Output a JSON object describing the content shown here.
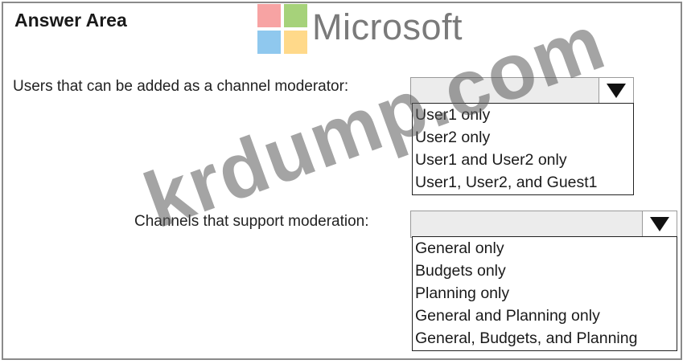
{
  "answer_area": {
    "title": "Answer Area"
  },
  "brand": {
    "name": "Microsoft",
    "logo_colors": [
      "#f25022",
      "#7fba00",
      "#00a4ef",
      "#ffb900"
    ]
  },
  "watermark": {
    "text": "krdump.com"
  },
  "questions": [
    {
      "label": "Users that can be added as a channel moderator:",
      "selected": "",
      "options": [
        "User1 only",
        "User2 only",
        "User1 and User2 only",
        "User1, User2, and Guest1"
      ]
    },
    {
      "label": "Channels that support moderation:",
      "selected": "",
      "options": [
        "General only",
        "Budgets only",
        "Planning only",
        "General and Planning only",
        "General, Budgets, and Planning"
      ]
    }
  ]
}
